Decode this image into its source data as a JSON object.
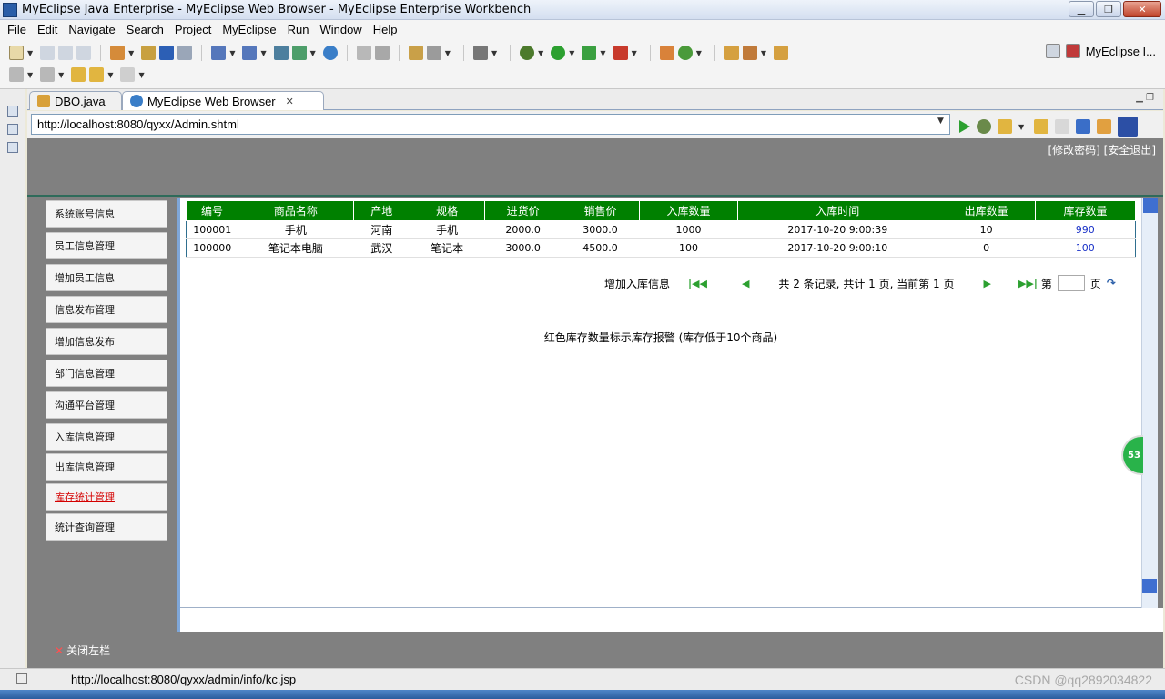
{
  "window": {
    "title": "MyEclipse Java Enterprise - MyEclipse Web Browser - MyEclipse Enterprise Workbench"
  },
  "menu": [
    "File",
    "Edit",
    "Navigate",
    "Search",
    "Project",
    "MyEclipse",
    "Run",
    "Window",
    "Help"
  ],
  "perspective": {
    "label": "MyEclipse I..."
  },
  "tabs": [
    {
      "label": "DBO.java",
      "icon": "java-file-icon"
    },
    {
      "label": "MyEclipse Web Browser",
      "icon": "globe-icon"
    }
  ],
  "browser": {
    "url": "http://localhost:8080/qyxx/Admin.shtml"
  },
  "page": {
    "header_links": "[修改密码] [安全退出]",
    "sidebar": [
      {
        "label": "系统账号信息"
      },
      {
        "label": "员工信息管理"
      },
      {
        "label": "增加员工信息"
      },
      {
        "label": "信息发布管理"
      },
      {
        "label": "增加信息发布"
      },
      {
        "label": "部门信息管理"
      },
      {
        "label": "沟通平台管理"
      },
      {
        "label": "入库信息管理"
      },
      {
        "label": "出库信息管理"
      },
      {
        "label": "库存统计管理",
        "active": true
      },
      {
        "label": "统计查询管理"
      }
    ],
    "table": {
      "columns": [
        "编号",
        "商品名称",
        "产地",
        "规格",
        "进货价",
        "销售价",
        "入库数量",
        "入库时间",
        "出库数量",
        "库存数量"
      ],
      "rows": [
        [
          "100001",
          "手机",
          "河南",
          "手机",
          "2000.0",
          "3000.0",
          "1000",
          "2017-10-20 9:00:39",
          "10",
          "990"
        ],
        [
          "100000",
          "笔记本电脑",
          "武汉",
          "笔记本",
          "3000.0",
          "4500.0",
          "100",
          "2017-10-20 9:00:10",
          "0",
          "100"
        ]
      ]
    },
    "pager": {
      "add_label": "增加入库信息",
      "info": "共 2 条记录, 共计 1 页, 当前第 1 页",
      "go_prefix": "第",
      "go_suffix": "页"
    },
    "warning": "红色库存数量标示库存报警 (库存低于10个商品)",
    "close_sidebar": "关闭左栏"
  },
  "badge": {
    "count": "53"
  },
  "status": {
    "url": "http://localhost:8080/qyxx/admin/info/kc.jsp",
    "watermark": "CSDN @qq2892034822"
  },
  "colors": {
    "table_header": "#008000",
    "stock_value": "#1a32c8",
    "active_menu": "#d40000",
    "page_bg": "#808080"
  }
}
